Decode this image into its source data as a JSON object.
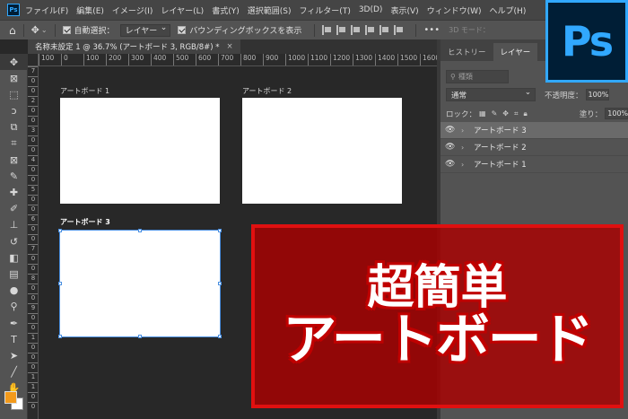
{
  "menubar": {
    "items": [
      "ファイル(F)",
      "編集(E)",
      "イメージ(I)",
      "レイヤー(L)",
      "書式(Y)",
      "選択範囲(S)",
      "フィルター(T)",
      "3D(D)",
      "表示(V)",
      "ウィンドウ(W)",
      "ヘルプ(H)"
    ]
  },
  "options": {
    "auto_select_label": "自動選択：",
    "auto_select_value": "レイヤー",
    "bbox_label": "バウンディングボックスを表示",
    "mode_3d": "3D モード："
  },
  "document": {
    "tab_title": "名称未設定 1 @ 36.7% (アートボード 3, RGB/8#) *"
  },
  "rulers": {
    "h": [
      "100",
      "0",
      "100",
      "200",
      "300",
      "400",
      "500",
      "600",
      "700",
      "800",
      "900",
      "1000",
      "1100",
      "1200",
      "1300",
      "1400",
      "1500",
      "1600"
    ],
    "v": [
      "7",
      "0",
      "0",
      "2",
      "0",
      "0",
      "3",
      "0",
      "0",
      "4",
      "0",
      "0",
      "5",
      "0",
      "0",
      "6",
      "0",
      "0",
      "7",
      "0",
      "0",
      "8",
      "0",
      "0",
      "9",
      "0",
      "0",
      "1",
      "0",
      "0",
      "0",
      "1",
      "1",
      "0",
      "0"
    ]
  },
  "artboards": [
    {
      "label": "アートボード 1",
      "selected": false
    },
    {
      "label": "アートボード 2",
      "selected": false
    },
    {
      "label": "アートボード 3",
      "selected": true
    }
  ],
  "panel": {
    "tabs": [
      "ヒストリー",
      "レイヤー"
    ],
    "active_tab": "レイヤー",
    "search_placeholder": "種類",
    "blend_mode": "通常",
    "opacity_label": "不透明度：",
    "opacity_value": "100%",
    "lock_label": "ロック：",
    "fill_label": "塗り：",
    "fill_value": "100%",
    "layers": [
      {
        "name": "アートボード 3",
        "selected": true
      },
      {
        "name": "アートボード 2",
        "selected": false
      },
      {
        "name": "アートボード 1",
        "selected": false
      }
    ]
  },
  "logo": {
    "text": "Ps"
  },
  "banner": {
    "line1": "超簡単",
    "line2": "アートボード"
  },
  "colors": {
    "foreground": "#f39a1b",
    "background": "#ffffff",
    "banner_fill": "#aa0000",
    "banner_border": "#e01010",
    "selection": "#4a8fe0",
    "logo_blue": "#31a8ff",
    "logo_bg": "#001e36"
  },
  "tools": [
    "move-tool",
    "artboard-tool",
    "marquee-tool",
    "lasso-tool",
    "object-select-tool",
    "crop-tool",
    "frame-tool",
    "eyedropper-tool",
    "healing-brush-tool",
    "brush-tool",
    "clone-stamp-tool",
    "history-brush-tool",
    "eraser-tool",
    "gradient-tool",
    "blur-tool",
    "dodge-tool",
    "pen-tool",
    "type-tool",
    "path-select-tool",
    "line-tool",
    "hand-tool",
    "zoom-tool"
  ]
}
